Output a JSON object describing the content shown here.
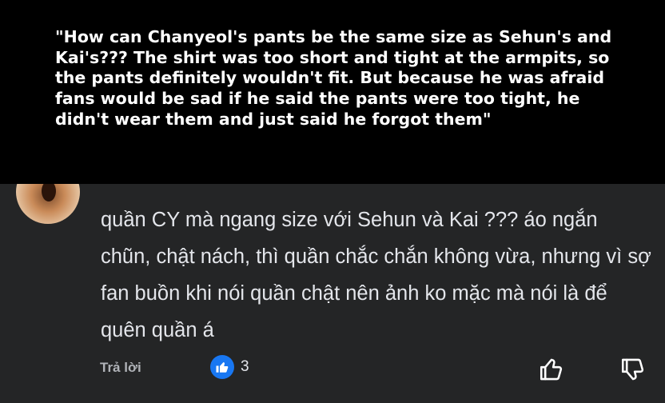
{
  "translation": {
    "text": "\"How can Chanyeol's pants be the same size as Sehun's and Kai's??? The shirt was too short and tight at the armpits, so the pants definitely wouldn't fit. But because he was afraid fans would be sad if he said the pants were too tight, he didn't wear them and just said he forgot them\""
  },
  "comment": {
    "text": "quần CY mà ngang size với Sehun và Kai ??? áo ngắn chũn, chật nách, thì quần chắc chắn không vừa, nhưng vì sợ fan buồn khi nói quần chật nên ảnh ko mặc mà nói là để quên quần á",
    "reply_label": "Trả lời",
    "reaction_count": "3",
    "reaction_icon": "like-icon",
    "reaction_color": "#1877f2"
  },
  "icons": {
    "thumbs_up": "thumbs-up-icon",
    "thumbs_down": "thumbs-down-icon"
  }
}
